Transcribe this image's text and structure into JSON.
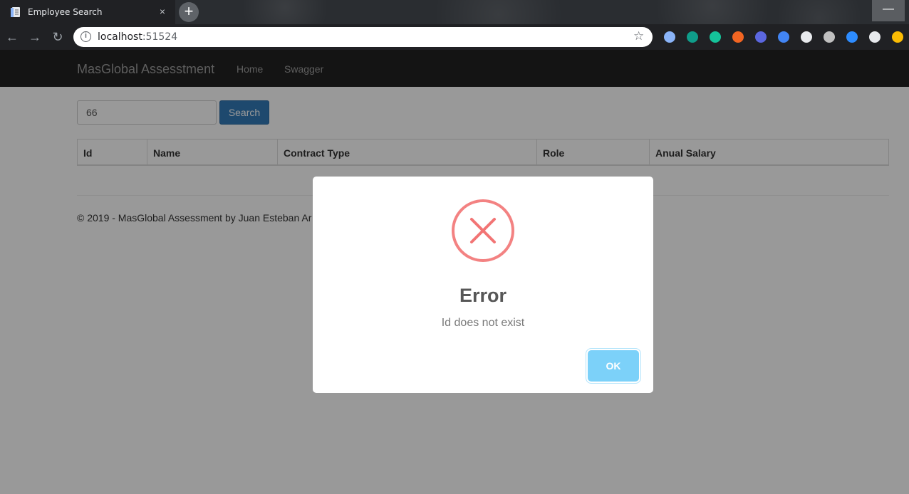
{
  "browser": {
    "tab_title": "Employee Search",
    "tab_close": "×",
    "new_tab": "+",
    "minimize": "—",
    "back": "←",
    "forward": "→",
    "reload": "↻",
    "url_host": "localhost",
    "url_port": ":51524",
    "info": "i",
    "star": "☆",
    "extension_colors": [
      "#8ab4f8",
      "#0f9d8a",
      "#15c39a",
      "#f26522",
      "#5b67e0",
      "#4285f4",
      "#e8eaed",
      "#c0c0c0",
      "#2d8cff",
      "#e8eaed",
      "#fbbc04"
    ]
  },
  "navbar": {
    "brand": "MasGlobal Assesstment",
    "links": [
      "Home",
      "Swagger"
    ]
  },
  "search": {
    "value": "66",
    "button": "Search"
  },
  "table": {
    "headers": [
      "Id",
      "Name",
      "Contract Type",
      "Role",
      "Anual Salary"
    ]
  },
  "footer": {
    "text": "© 2019 - MasGlobal Assessment by Juan Esteban Ar"
  },
  "dialog": {
    "title": "Error",
    "message": "Id does not exist",
    "ok": "OK",
    "icon_color": "#f27474",
    "ok_color": "#7cd1f9"
  }
}
